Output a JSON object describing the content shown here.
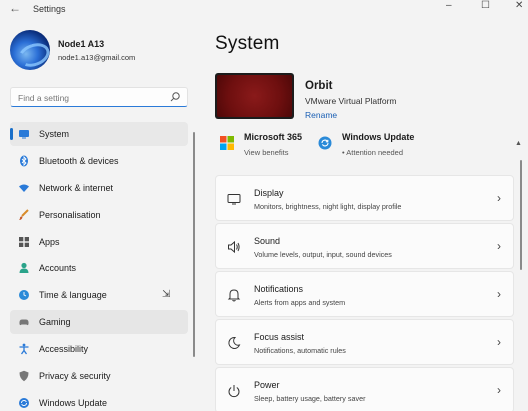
{
  "window": {
    "title": "Settings",
    "back_glyph": "←",
    "min_glyph": "–",
    "max_glyph": "☐",
    "close_glyph": "✕"
  },
  "profile": {
    "name": "Node1 A13",
    "email": "node1.a13@gmail.com"
  },
  "search": {
    "placeholder": "Find a setting"
  },
  "sidebar": {
    "items": [
      {
        "label": "System",
        "icon": "monitor-icon",
        "state": "active"
      },
      {
        "label": "Bluetooth & devices",
        "icon": "bluetooth-icon"
      },
      {
        "label": "Network & internet",
        "icon": "wifi-icon"
      },
      {
        "label": "Personalisation",
        "icon": "brush-icon"
      },
      {
        "label": "Apps",
        "icon": "apps-grid-icon"
      },
      {
        "label": "Accounts",
        "icon": "person-icon"
      },
      {
        "label": "Time & language",
        "icon": "globe-clock-icon"
      },
      {
        "label": "Gaming",
        "icon": "gamepad-icon",
        "state": "hover"
      },
      {
        "label": "Accessibility",
        "icon": "accessibility-icon"
      },
      {
        "label": "Privacy & security",
        "icon": "shield-icon"
      },
      {
        "label": "Windows Update",
        "icon": "windows-update-icon"
      }
    ]
  },
  "main": {
    "title": "System",
    "device": {
      "name": "Orbit",
      "model": "VMware Virtual Platform",
      "rename_label": "Rename"
    },
    "quick_links": [
      {
        "title": "Microsoft 365",
        "subtitle": "View benefits",
        "icon": "microsoft-logo-icon"
      },
      {
        "title": "Windows Update",
        "subtitle": "• Attention needed",
        "icon": "sync-icon"
      }
    ],
    "cards": [
      {
        "title": "Display",
        "subtitle": "Monitors, brightness, night light, display profile",
        "icon": "display-icon"
      },
      {
        "title": "Sound",
        "subtitle": "Volume levels, output, input, sound devices",
        "icon": "speaker-icon"
      },
      {
        "title": "Notifications",
        "subtitle": "Alerts from apps and system",
        "icon": "bell-icon"
      },
      {
        "title": "Focus assist",
        "subtitle": "Notifications, automatic rules",
        "icon": "moon-icon"
      },
      {
        "title": "Power",
        "subtitle": "Sleep, battery usage, battery saver",
        "icon": "power-icon"
      }
    ]
  },
  "colors": {
    "accent": "#1a6fc9",
    "background": "#f3f3f3",
    "card": "#fbfbfb"
  }
}
